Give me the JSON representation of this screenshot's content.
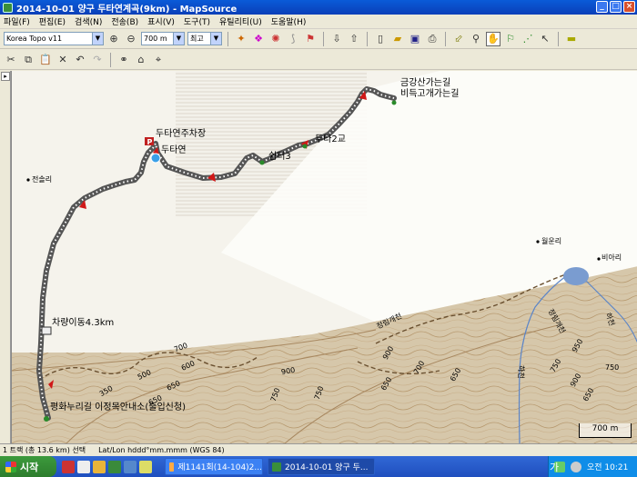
{
  "window": {
    "title": "2014-10-01 양구 두타연계곡(9km) - MapSource",
    "controls": [
      "_",
      "□",
      "×"
    ]
  },
  "menu": [
    "파일(F)",
    "편집(E)",
    "검색(N)",
    "전송(B)",
    "표시(V)",
    "도구(T)",
    "유틸리티(U)",
    "도움말(H)"
  ],
  "toolbar": {
    "map_product": "Korea Topo v11",
    "zoom_level": "700 m",
    "detail": "최고"
  },
  "map": {
    "labels": {
      "route_end_1": "금강산가는길",
      "route_end_2": "비득고개가는길",
      "parking": "두타연주차장",
      "dutayeon": "두타연",
      "dutagyo": "두타2교",
      "rest": "쉼터3",
      "village_left": "전솔리",
      "village_right": "월운리",
      "village_far": "비아리",
      "car_move": "차량이동4.3km",
      "start": "평화누리길 이정목안내소(출입신청)"
    },
    "contours": [
      "350",
      "500",
      "600",
      "650",
      "650",
      "700",
      "750",
      "900",
      "750",
      "900",
      "650",
      "700",
      "650",
      "750",
      "900",
      "950",
      "750",
      "650"
    ],
    "streams": [
      "정림개천",
      "정림개천",
      "하천",
      "하천"
    ],
    "scale": "700 m"
  },
  "status": {
    "selection": "1 트랙 (총 13.6 km) 선택",
    "coord_format": "Lat/Lon hddd°mm.mmm (WGS 84)"
  },
  "taskbar": {
    "start": "시작",
    "tasks": [
      "제1141회(14-104)2...",
      "2014-10-01 양구 두..."
    ],
    "ime": "가",
    "clock": "오전 10:21"
  }
}
